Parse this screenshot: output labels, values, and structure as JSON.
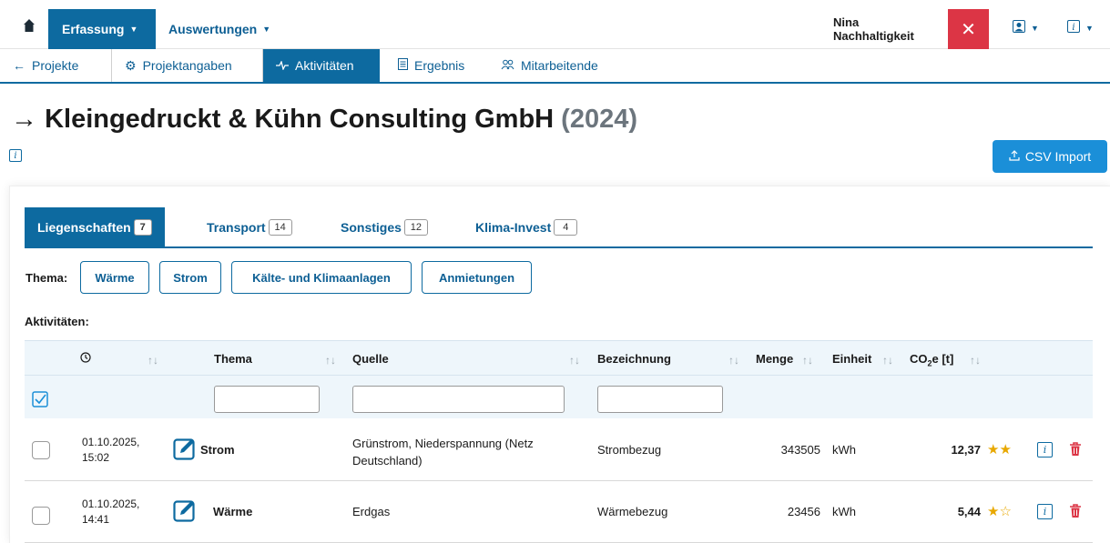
{
  "topnav": {
    "menu1": "Erfassung",
    "menu2": "Auswertungen",
    "user": "Nina Nachhaltigkeit",
    "close": "✕"
  },
  "subnav": {
    "back": "Projekte",
    "projekt": "Projektangaben",
    "aktiv": "Aktivitäten",
    "ergebnis": "Ergebnis",
    "mitarb": "Mitarbeitende"
  },
  "page": {
    "title": "Kleingedruckt & Kühn Consulting GmbH",
    "year": "(2024)",
    "csv": "CSV Import"
  },
  "tabs": [
    {
      "label": "Liegenschaften",
      "count": "7"
    },
    {
      "label": "Transport",
      "count": "14"
    },
    {
      "label": "Sonstiges",
      "count": "12"
    },
    {
      "label": "Klima-Invest",
      "count": "4"
    }
  ],
  "thema": {
    "label": "Thema:",
    "chips": [
      "Wärme",
      "Strom",
      "Kälte- und Klimaanlagen",
      "Anmietungen"
    ]
  },
  "aktivitaeten_label": "Aktivitäten:",
  "columns": {
    "thema": "Thema",
    "quelle": "Quelle",
    "bezeichnung": "Bezeichnung",
    "menge": "Menge",
    "einheit": "Einheit",
    "co2_pre": "CO",
    "co2_sub": "2",
    "co2_post": "e [t]"
  },
  "rows": [
    {
      "date": "01.10.2025,",
      "time": "15:02",
      "thema": "Strom",
      "quelle1": "Grünstrom, Niederspannung (Netz",
      "quelle2": "Deutschland)",
      "bez": "Strombezug",
      "menge": "343505",
      "einheit": "kWh",
      "co2": "12,37",
      "stars": "★★"
    },
    {
      "date": "01.10.2025,",
      "time": "14:41",
      "thema": "Wärme",
      "quelle1": "Erdgas",
      "quelle2": "",
      "bez": "Wärmebezug",
      "menge": "23456",
      "einheit": "kWh",
      "co2": "5,44",
      "stars": "★☆"
    }
  ],
  "colors": {
    "primary": "#0d6aa0",
    "accent": "#1b8fd8",
    "danger": "#dc3545",
    "star": "#e8a800"
  },
  "icons": [
    "home-icon",
    "close-icon",
    "person-icon",
    "info-icon",
    "gear-icon",
    "activity-icon",
    "document-icon",
    "people-icon",
    "upload-icon",
    "clock-icon",
    "edit-icon",
    "trash-icon",
    "checkbox-icon"
  ]
}
